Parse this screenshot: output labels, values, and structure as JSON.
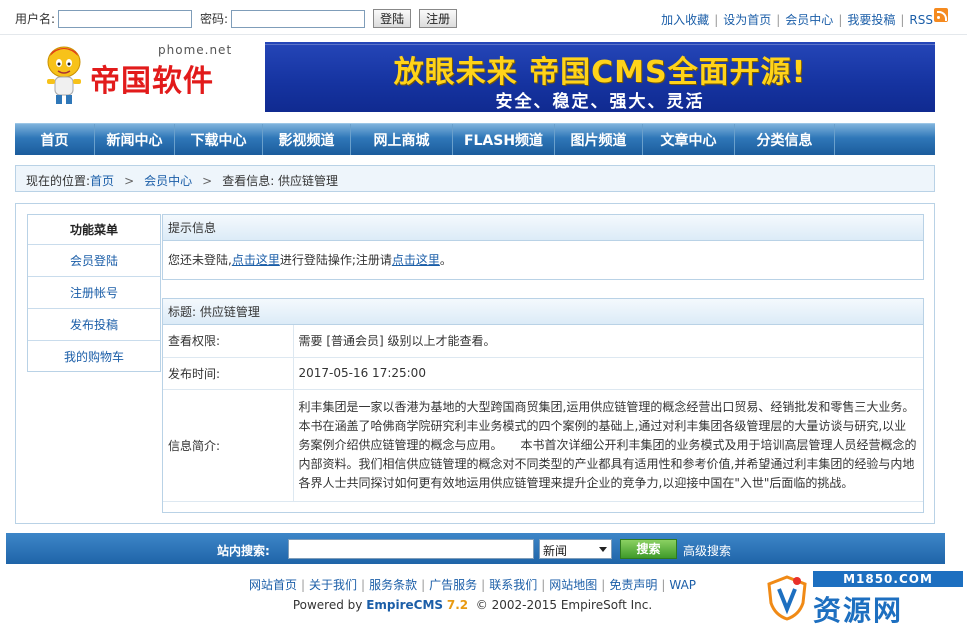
{
  "topbar": {
    "username_label": "用户名:",
    "password_label": "密码:",
    "login_button": "登陆",
    "register_button": "注册",
    "links": [
      "加入收藏",
      "设为首页",
      "会员中心",
      "我要投稿",
      "RSS"
    ]
  },
  "header": {
    "logo_domain": "phome.net",
    "logo_name": "帝国软件",
    "banner_headline": "放眼未来 帝国CMS全面开源!",
    "banner_sub": "安全、稳定、强大、灵活"
  },
  "nav": {
    "items": [
      "首页",
      "新闻中心",
      "下载中心",
      "影视频道",
      "网上商城",
      "FLASH频道",
      "图片频道",
      "文章中心",
      "分类信息"
    ]
  },
  "breadcrumb": {
    "prefix": "现在的位置:",
    "home": "首页",
    "member": "会员中心",
    "current": "查看信息: 供应链管理",
    "arrow": ">"
  },
  "sidebar": {
    "title": "功能菜单",
    "items": [
      "会员登陆",
      "注册帐号",
      "发布投稿",
      "我的购物车"
    ]
  },
  "notice": {
    "title": "提示信息",
    "text_1": "您还未登陆,",
    "link_1": "点击这里",
    "text_2": "进行登陆操作;注册请",
    "link_2": "点击这里",
    "text_3": "。"
  },
  "info": {
    "title": "标题: 供应链管理",
    "rows": [
      {
        "key": "查看权限:",
        "value": "需要 [普通会员] 级别以上才能查看。"
      },
      {
        "key": "发布时间:",
        "value": "2017-05-16 17:25:00"
      },
      {
        "key": "信息简介:",
        "value": "利丰集团是一家以香港为基地的大型跨国商贸集团,运用供应链管理的概念经营出口贸易、经销批发和零售三大业务。本书在涵盖了哈佛商学院研究利丰业务模式的四个案例的基础上,通过对利丰集团各级管理层的大量访谈与研究,以业务案例介绍供应链管理的概念与应用。　　本书首次详细公开利丰集团的业务模式及用于培训高层管理人员经营概念的内部资料。我们相信供应链管理的概念对不同类型的产业都具有适用性和参考价值,并希望通过利丰集团的经验与内地各界人士共同探讨如何更有效地运用供应链管理来提升企业的竞争力,以迎接中国在\"入世\"后面临的挑战。"
      }
    ]
  },
  "search": {
    "label": "站内搜索:",
    "value": "",
    "select_value": "新闻",
    "button": "搜索",
    "advanced": "高级搜索"
  },
  "footer": {
    "links": [
      "网站首页",
      "关于我们",
      "服务条款",
      "广告服务",
      "联系我们",
      "网站地图",
      "免责声明",
      "WAP"
    ],
    "powered_prefix": "Powered by ",
    "powered_brand": "EmpireCMS",
    "powered_version": "7.2",
    "copyright": "© 2002-2015 EmpireSoft Inc."
  },
  "watermark": {
    "domain": "M1850.COM",
    "name": "资源网"
  },
  "colors": {
    "link": "#1b5ea8",
    "nav_bg": "#2f77b8",
    "banner_bg": "#1533a0",
    "banner_headline": "#ffd31a",
    "logo_red": "#e21b1b",
    "search_button": "#3f9a2a",
    "watermark_blue": "#1d6fc0"
  }
}
